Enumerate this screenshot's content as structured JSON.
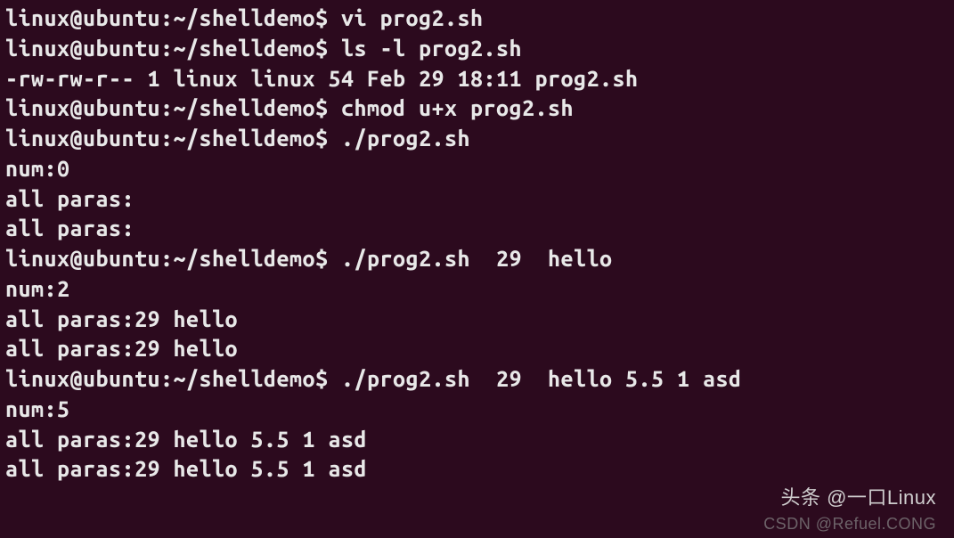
{
  "terminal": {
    "lines": [
      "linux@ubuntu:~/shelldemo$ vi prog2.sh",
      "linux@ubuntu:~/shelldemo$ ls -l prog2.sh",
      "-rw-rw-r-- 1 linux linux 54 Feb 29 18:11 prog2.sh",
      "linux@ubuntu:~/shelldemo$ chmod u+x prog2.sh",
      "linux@ubuntu:~/shelldemo$ ./prog2.sh",
      "num:0",
      "all paras:",
      "all paras:",
      "linux@ubuntu:~/shelldemo$ ./prog2.sh  29  hello",
      "num:2",
      "all paras:29 hello",
      "all paras:29 hello",
      "linux@ubuntu:~/shelldemo$ ./prog2.sh  29  hello 5.5 1 asd",
      "num:5",
      "all paras:29 hello 5.5 1 asd",
      "all paras:29 hello 5.5 1 asd"
    ],
    "prompt": "linux@ubuntu:~/shelldemo$",
    "user": "linux",
    "host": "ubuntu",
    "cwd": "~/shelldemo"
  },
  "watermarks": {
    "top": "头条 @一口Linux",
    "bottom": "CSDN @Refuel.CONG"
  }
}
